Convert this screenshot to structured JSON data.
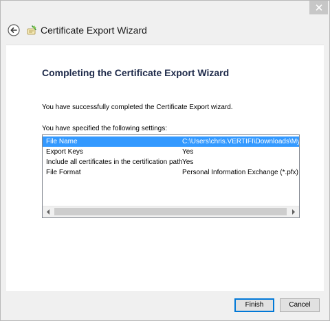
{
  "window": {
    "title": "Certificate Export Wizard",
    "close_icon": "close-icon",
    "back_icon": "back-arrow-icon",
    "wizard_icon": "certificate-wizard-icon"
  },
  "page": {
    "heading": "Completing the Certificate Export Wizard",
    "success_text": "You have successfully completed the Certificate Export wizard.",
    "settings_label": "You have specified the following settings:"
  },
  "settings": {
    "rows": [
      {
        "name": "File Name",
        "value": "C:\\Users\\chris.VERTIFI\\Downloads\\My",
        "selected": true
      },
      {
        "name": "Export Keys",
        "value": "Yes",
        "selected": false
      },
      {
        "name": "Include all certificates in the certification path",
        "value": "Yes",
        "selected": false
      },
      {
        "name": "File Format",
        "value": "Personal Information Exchange (*.pfx)",
        "selected": false
      }
    ]
  },
  "buttons": {
    "finish": "Finish",
    "cancel": "Cancel"
  },
  "colors": {
    "selection": "#3399ff",
    "heading": "#1e2a4a",
    "default_button_border": "#0078d7"
  }
}
